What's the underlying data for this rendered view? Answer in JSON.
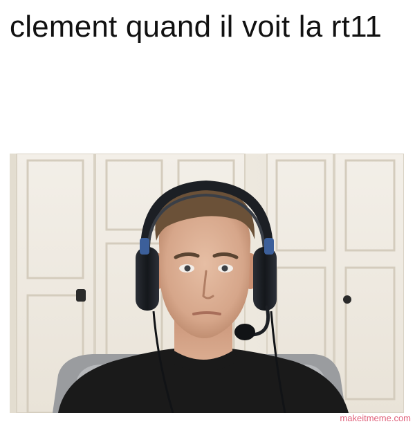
{
  "caption": {
    "text": "clement quand il voit la rt11"
  },
  "photo": {
    "subject": "person-with-headset",
    "background": "white-doors",
    "colors": {
      "wall": "#ece7dc",
      "door": "#f1ede5",
      "shirt": "#1a1a1a",
      "headset": "#1c1f24",
      "hair": "#6b5138",
      "skin": "#d8ab90"
    }
  },
  "watermark": {
    "text": "makeitmeme.com",
    "color": "#e0607a"
  }
}
